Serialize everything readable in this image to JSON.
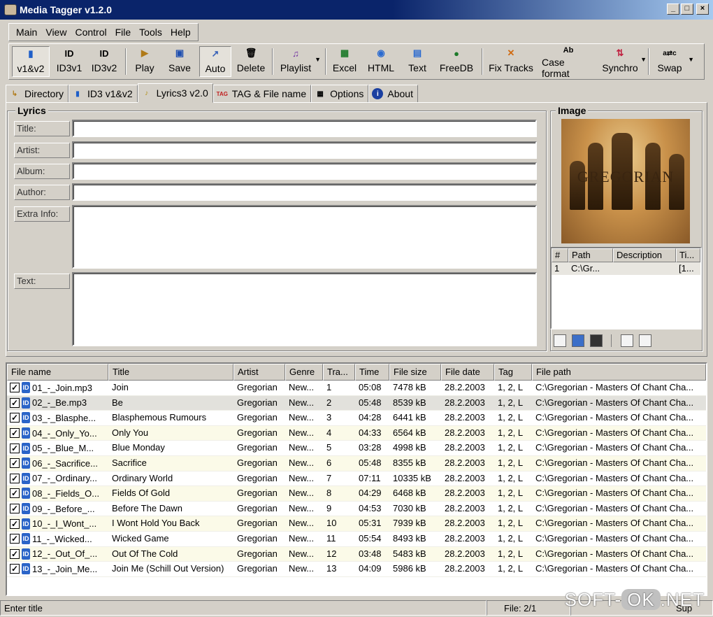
{
  "window": {
    "title": "Media Tagger v1.2.0"
  },
  "menu": [
    "Main",
    "View",
    "Control",
    "File",
    "Tools",
    "Help"
  ],
  "toolbar": [
    {
      "label": "v1&v2",
      "icon": "id3-v1v2-icon"
    },
    {
      "label": "ID3v1",
      "icon": "id3v1-icon"
    },
    {
      "label": "ID3v2",
      "icon": "id3v2-icon"
    },
    {
      "label": "Play",
      "icon": "play-icon"
    },
    {
      "label": "Save",
      "icon": "save-icon"
    },
    {
      "label": "Auto",
      "icon": "auto-icon"
    },
    {
      "label": "Delete",
      "icon": "delete-icon"
    },
    {
      "label": "Playlist",
      "icon": "playlist-icon"
    },
    {
      "label": "Excel",
      "icon": "excel-icon"
    },
    {
      "label": "HTML",
      "icon": "html-icon"
    },
    {
      "label": "Text",
      "icon": "text-icon"
    },
    {
      "label": "FreeDB",
      "icon": "freedb-icon"
    },
    {
      "label": "Fix Tracks",
      "icon": "fix-tracks-icon"
    },
    {
      "label": "Case format",
      "icon": "case-format-icon"
    },
    {
      "label": "Synchro",
      "icon": "synchro-icon"
    },
    {
      "label": "Swap",
      "icon": "swap-icon"
    }
  ],
  "tabs": [
    "Directory",
    "ID3 v1&v2",
    "Lyrics3 v2.0",
    "TAG & File name",
    "Options",
    "About"
  ],
  "lyrics": {
    "group_title": "Lyrics",
    "labels": [
      "Title:",
      "Artist:",
      "Album:",
      "Author:",
      "Extra Info:",
      "Text:"
    ],
    "values": [
      "",
      "",
      "",
      "",
      "",
      ""
    ]
  },
  "image": {
    "group_title": "Image",
    "cover_text": "GREGORIAN",
    "columns": [
      "#",
      "Path",
      "Description",
      "Ti..."
    ],
    "rows": [
      [
        "1",
        "C:\\Gr...",
        "",
        "[1..."
      ]
    ]
  },
  "files": {
    "columns": [
      "File name",
      "Title",
      "Artist",
      "Genre",
      "Tra...",
      "Time",
      "File size",
      "File date",
      "Tag",
      "File path"
    ],
    "rows": [
      [
        "01_-_Join.mp3",
        "Join",
        "Gregorian",
        "New...",
        "1",
        "05:08",
        "7478 kB",
        "28.2.2003",
        "1, 2, L",
        "C:\\Gregorian - Masters Of Chant Cha..."
      ],
      [
        "02_-_Be.mp3",
        "Be",
        "Gregorian",
        "New...",
        "2",
        "05:48",
        "8539 kB",
        "28.2.2003",
        "1, 2, L",
        "C:\\Gregorian - Masters Of Chant Cha..."
      ],
      [
        "03_-_Blasphe...",
        "Blasphemous Rumours",
        "Gregorian",
        "New...",
        "3",
        "04:28",
        "6441 kB",
        "28.2.2003",
        "1, 2, L",
        "C:\\Gregorian - Masters Of Chant Cha..."
      ],
      [
        "04_-_Only_Yo...",
        "Only You",
        "Gregorian",
        "New...",
        "4",
        "04:33",
        "6564 kB",
        "28.2.2003",
        "1, 2, L",
        "C:\\Gregorian - Masters Of Chant Cha..."
      ],
      [
        "05_-_Blue_M...",
        "Blue Monday",
        "Gregorian",
        "New...",
        "5",
        "03:28",
        "4998 kB",
        "28.2.2003",
        "1, 2, L",
        "C:\\Gregorian - Masters Of Chant Cha..."
      ],
      [
        "06_-_Sacrifice...",
        "Sacrifice",
        "Gregorian",
        "New...",
        "6",
        "05:48",
        "8355 kB",
        "28.2.2003",
        "1, 2, L",
        "C:\\Gregorian - Masters Of Chant Cha..."
      ],
      [
        "07_-_Ordinary...",
        "Ordinary World",
        "Gregorian",
        "New...",
        "7",
        "07:11",
        "10335 kB",
        "28.2.2003",
        "1, 2, L",
        "C:\\Gregorian - Masters Of Chant Cha..."
      ],
      [
        "08_-_Fields_O...",
        "Fields Of Gold",
        "Gregorian",
        "New...",
        "8",
        "04:29",
        "6468 kB",
        "28.2.2003",
        "1, 2, L",
        "C:\\Gregorian - Masters Of Chant Cha..."
      ],
      [
        "09_-_Before_...",
        "Before The Dawn",
        "Gregorian",
        "New...",
        "9",
        "04:53",
        "7030 kB",
        "28.2.2003",
        "1, 2, L",
        "C:\\Gregorian - Masters Of Chant Cha..."
      ],
      [
        "10_-_I_Wont_...",
        "I Wont Hold You Back",
        "Gregorian",
        "New...",
        "10",
        "05:31",
        "7939 kB",
        "28.2.2003",
        "1, 2, L",
        "C:\\Gregorian - Masters Of Chant Cha..."
      ],
      [
        "11_-_Wicked...",
        "Wicked Game",
        "Gregorian",
        "New...",
        "11",
        "05:54",
        "8493 kB",
        "28.2.2003",
        "1, 2, L",
        "C:\\Gregorian - Masters Of Chant Cha..."
      ],
      [
        "12_-_Out_Of_...",
        "Out Of The Cold",
        "Gregorian",
        "New...",
        "12",
        "03:48",
        "5483 kB",
        "28.2.2003",
        "1, 2, L",
        "C:\\Gregorian - Masters Of Chant Cha..."
      ],
      [
        "13_-_Join_Me...",
        "Join Me (Schill Out Version)",
        "Gregorian",
        "New...",
        "13",
        "04:09",
        "5986 kB",
        "28.2.2003",
        "1, 2, L",
        "C:\\Gregorian - Masters Of Chant Cha..."
      ]
    ]
  },
  "status": {
    "hint": "Enter title",
    "file_count": "File: 2/1",
    "extra": "Sup"
  },
  "watermark": {
    "left": "SOFT-",
    "mid": "OK",
    "right": ".NET"
  }
}
